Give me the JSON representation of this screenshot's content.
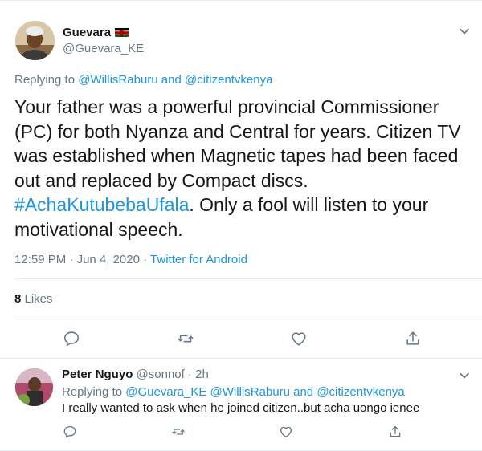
{
  "tweet": {
    "author_name": "Guevara",
    "author_handle": "@Guevara_KE",
    "replying_prefix": "Replying to ",
    "replying_user1": "@WillisRaburu",
    "replying_and": " and ",
    "replying_user2": "@citizentvkenya",
    "text_before": "Your father was a powerful provincial Commissioner (PC) for both Nyanza and Central for years. Citizen TV was established when Magnetic tapes had been faced out and replaced by Compact discs. ",
    "hashtag": "#AchaKutubebaUfala",
    "text_after": ". Only a fool will listen to your motivational speech.",
    "time": "12:59 PM",
    "dot1": " · ",
    "date": "Jun 4, 2020",
    "dot2": " · ",
    "source": "Twitter for Android",
    "likes_count": "8",
    "likes_label": " Likes",
    "flag_icon": "kenya-flag-icon"
  },
  "reply": {
    "author_name": "Peter Nguyo",
    "author_handle": " @sonnof",
    "dot": " · ",
    "age": "2h",
    "replying_prefix": "Replying to ",
    "replying_user1": "@Guevara_KE",
    "replying_user2": "@WillisRaburu",
    "replying_and": " and ",
    "replying_user3": "@citizentvkenya",
    "text": "I really wanted to ask when he joined citizen..but acha uongo ienee"
  },
  "colors": {
    "link": "#1b95e0",
    "secondary_text": "#657786",
    "primary_text": "#14171a",
    "divider": "#e6ecf0"
  }
}
